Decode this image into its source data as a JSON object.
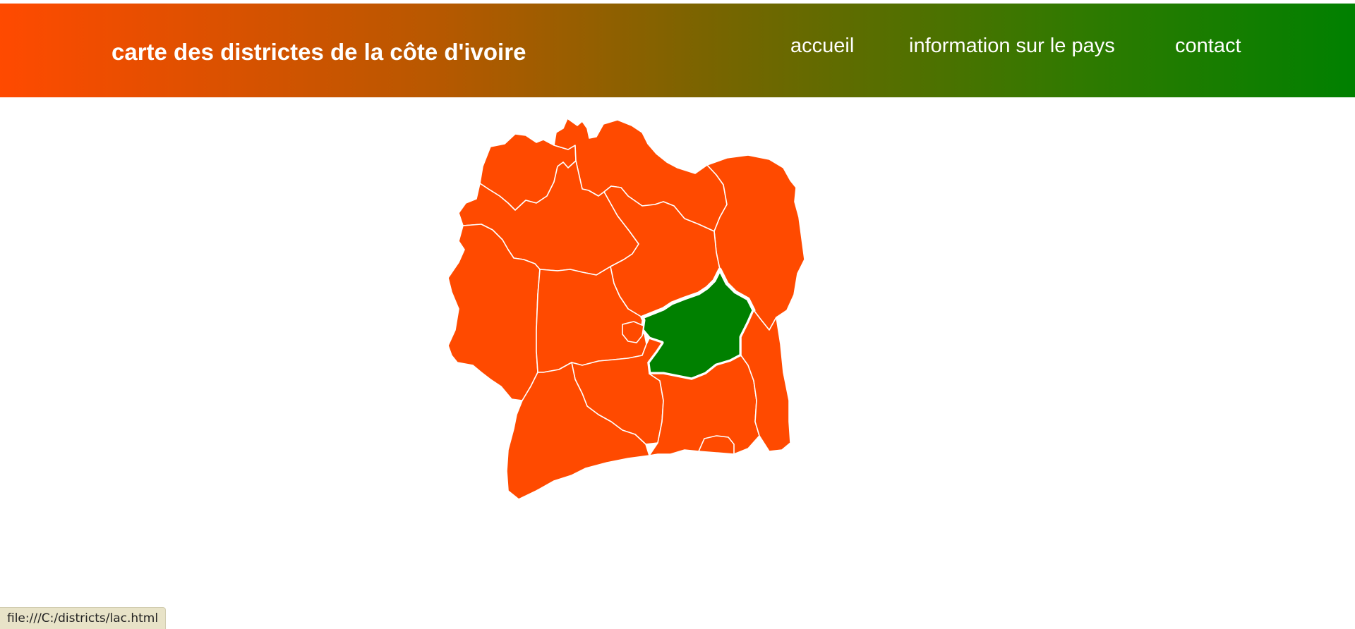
{
  "header": {
    "title": "carte des districtes de la côte d'ivoire",
    "gradient_start": "#ff4a00",
    "gradient_end": "#008000"
  },
  "nav": {
    "items": [
      {
        "label": "accueil"
      },
      {
        "label": "information sur le pays"
      },
      {
        "label": "contact"
      }
    ]
  },
  "map": {
    "district_color": "#ff4a00",
    "selected_color": "#008000",
    "border_color": "#ffffff",
    "selected_district": "lacs"
  },
  "status_bar": {
    "url": "file:///C:/districts/lac.html"
  }
}
